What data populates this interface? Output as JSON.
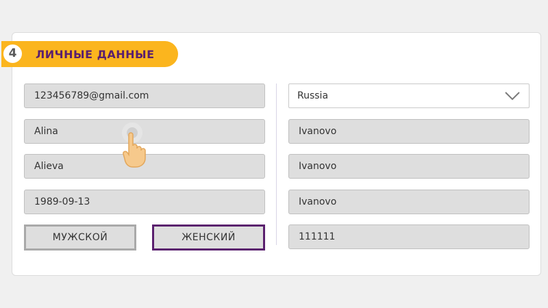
{
  "step": {
    "number": "4",
    "title": "ЛИЧНЫЕ ДАННЫЕ"
  },
  "left_fields": {
    "email": "123456789@gmail.com",
    "first_name": "Alina",
    "last_name": "Alieva",
    "birth_date": "1989-09-13"
  },
  "gender": {
    "male": "МУЖСКОЙ",
    "female": "ЖЕНСКИЙ",
    "selected": "female"
  },
  "right_fields": {
    "country": "Russia",
    "region": "Ivanovo",
    "city": "Ivanovo",
    "address": "Ivanovo",
    "postal_code": "111111"
  },
  "colors": {
    "accent_yellow": "#fbb51e",
    "accent_purple": "#5a1f6e",
    "field_bg": "#dedede"
  },
  "icons": {
    "dropdown": "chevron-down-icon",
    "cursor": "hand-pointer-icon"
  }
}
